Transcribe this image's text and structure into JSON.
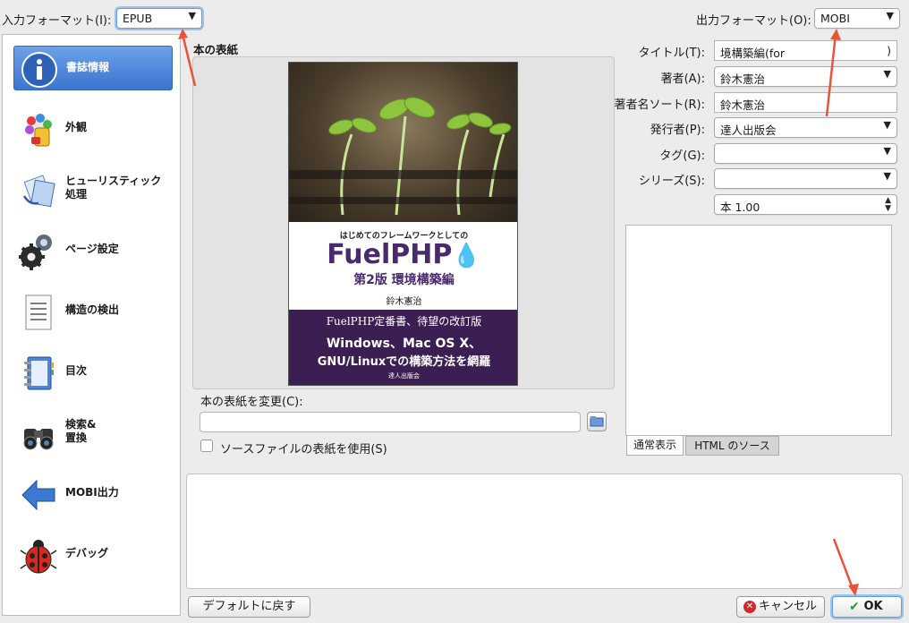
{
  "header": {
    "input_format_label": "入力フォーマット(I):",
    "input_format_value": "EPUB",
    "output_format_label": "出力フォーマット(O):",
    "output_format_value": "MOBI"
  },
  "sidebar": {
    "items": [
      {
        "label": "書誌情報",
        "icon": "info-icon"
      },
      {
        "label": "外観",
        "icon": "appearance-icon"
      },
      {
        "label": "ヒューリスティック 処理",
        "icon": "heuristics-icon"
      },
      {
        "label": "ページ設定",
        "icon": "gear-icon"
      },
      {
        "label": "構造の検出",
        "icon": "document-icon"
      },
      {
        "label": "目次",
        "icon": "notebook-icon"
      },
      {
        "label": "検索& 置換",
        "icon": "binoculars-icon"
      },
      {
        "label": "MOBI出力",
        "icon": "arrow-left-icon"
      },
      {
        "label": "デバッグ",
        "icon": "ladybug-icon"
      }
    ]
  },
  "cover": {
    "section_label": "本の表紙",
    "change_label": "本の表紙を変更(C):",
    "path_value": "",
    "use_source_label": "ソースファイルの表紙を使用(S)",
    "use_source_checked": false,
    "art": {
      "subtitle_small": "はじめてのフレームワークとしての",
      "brand": "FuelPHP",
      "edition": "第2版 環境構築編",
      "author": "鈴木憲治",
      "tagline": "FuelPHP定番書、待望の改訂版",
      "bottom_line1": "Windows、Mac OS X、",
      "bottom_line2": "GNU/Linuxでの構築方法を網羅",
      "publisher": "達人出版会"
    }
  },
  "metadata": {
    "title_label": "タイトル(T):",
    "title_value": "境構築編(for",
    "title_suffix": ")",
    "author_label": "著者(A):",
    "author_value": "鈴木憲治",
    "author_sort_label": "著者名ソート(R):",
    "author_sort_value": "鈴木憲治",
    "publisher_label": "発行者(P):",
    "publisher_value": "達人出版会",
    "tags_label": "タグ(G):",
    "tags_value": "",
    "series_label": "シリーズ(S):",
    "series_value": "",
    "series_index": "本 1.00"
  },
  "comment_tabs": {
    "normal": "通常表示",
    "html": "HTML のソース"
  },
  "footer": {
    "reset_label": "デフォルトに戻す",
    "cancel_label": "キャンセル",
    "ok_label": "OK"
  },
  "colors": {
    "accent": "#3c74d0",
    "annotation_arrow": "#e8543a",
    "cover_purple": "#3b1e52"
  }
}
